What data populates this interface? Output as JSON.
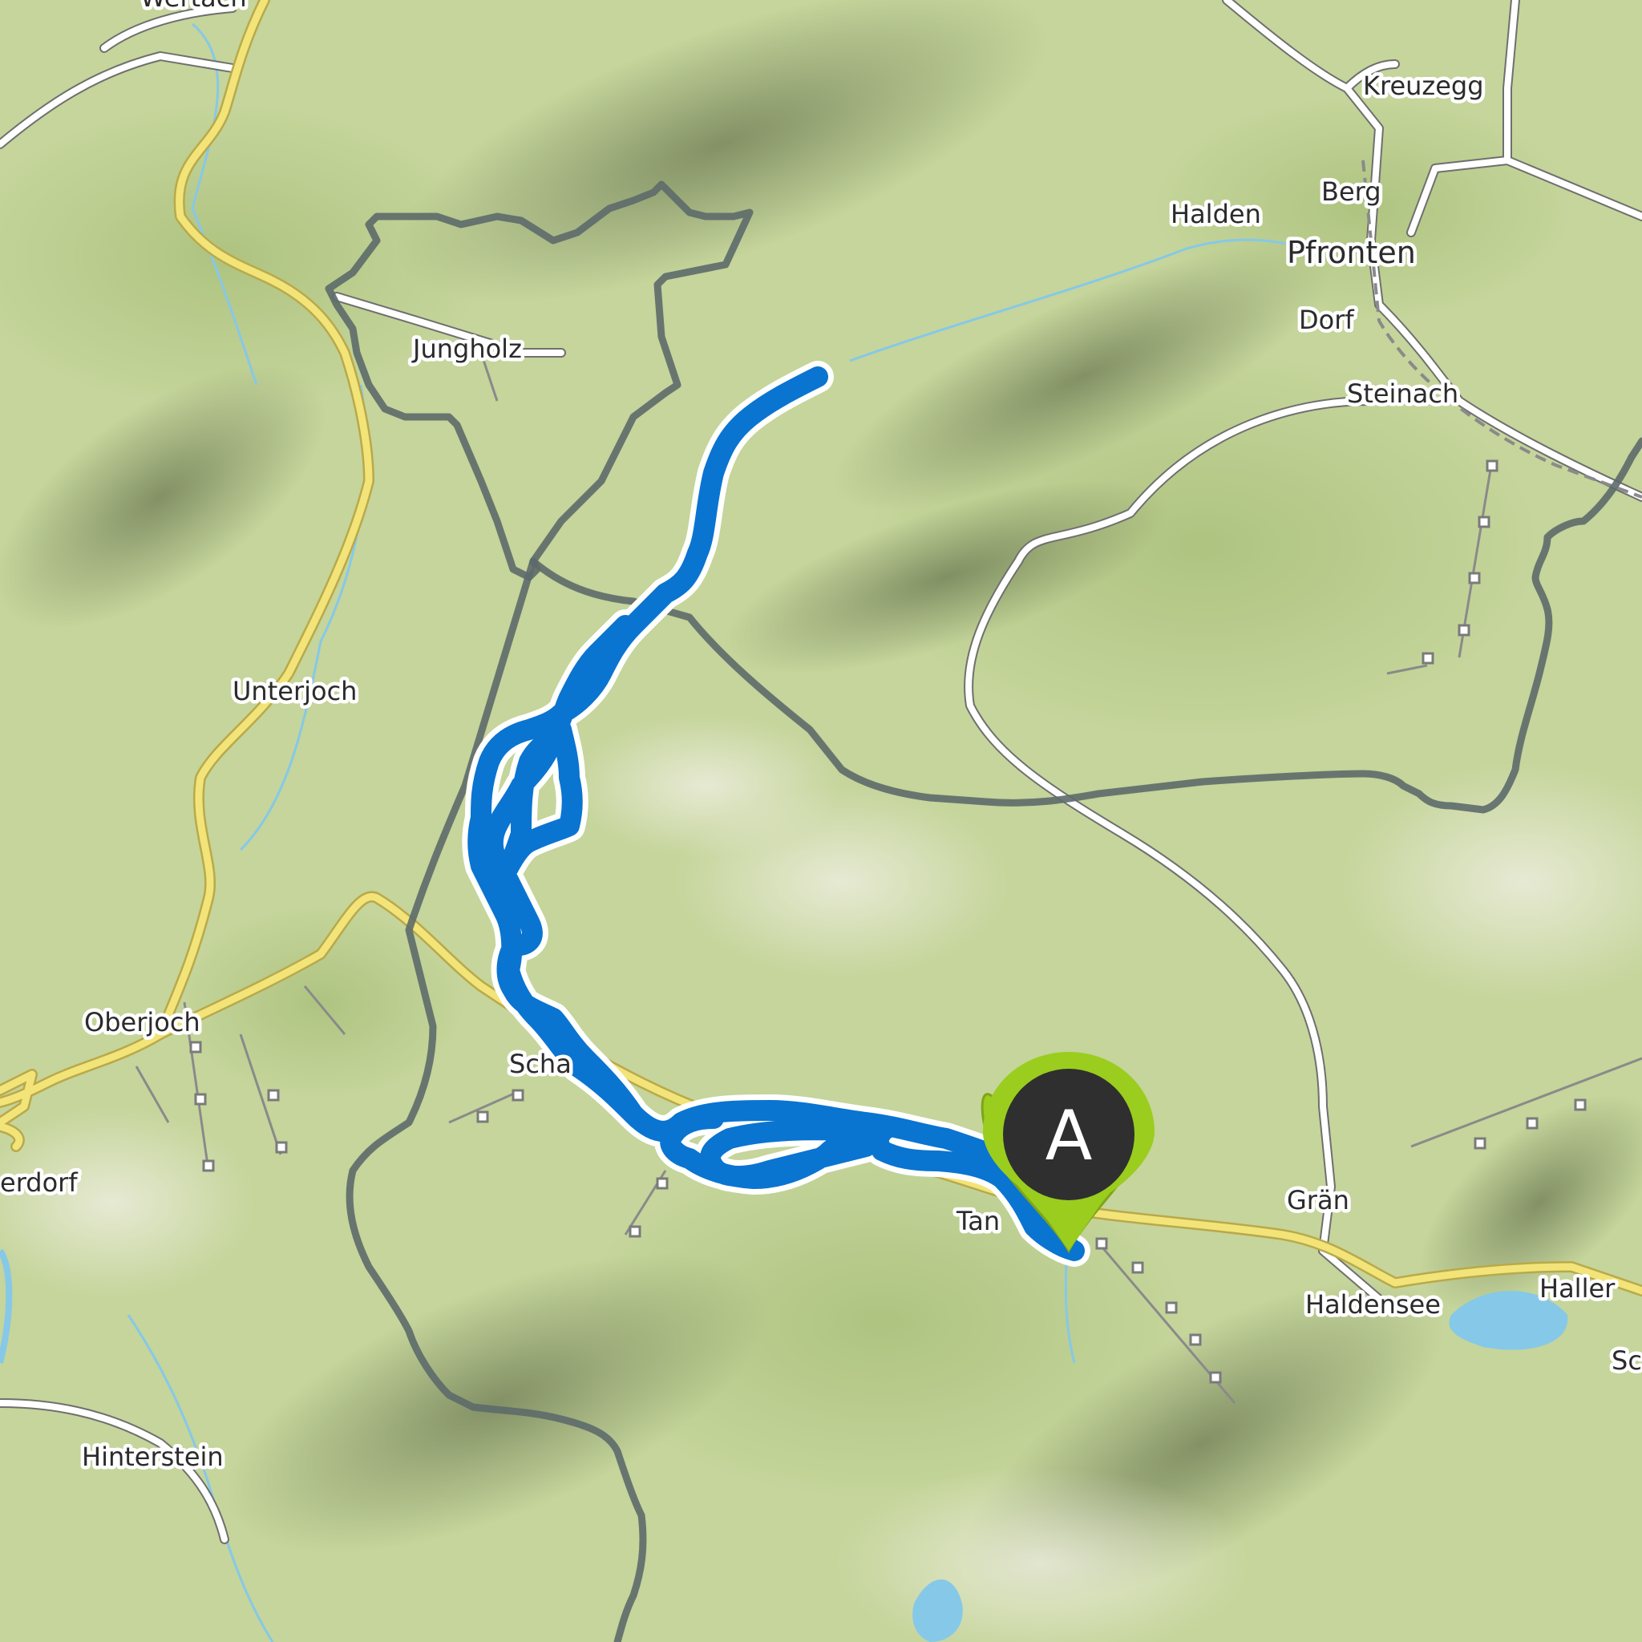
{
  "map": {
    "marker": {
      "label": "A",
      "name": "start-point"
    },
    "places": [
      {
        "id": "wertach",
        "text": "Wertach"
      },
      {
        "id": "kreuzegg",
        "text": "Kreuzegg"
      },
      {
        "id": "berg",
        "text": "Berg"
      },
      {
        "id": "halden",
        "text": "Halden"
      },
      {
        "id": "pfronten",
        "text": "Pfronten"
      },
      {
        "id": "dorf",
        "text": "Dorf"
      },
      {
        "id": "steinach",
        "text": "Steinach"
      },
      {
        "id": "jungholz",
        "text": "Jungholz"
      },
      {
        "id": "unterjoch",
        "text": "Unterjoch"
      },
      {
        "id": "oberjoch",
        "text": "Oberjoch"
      },
      {
        "id": "erdorf",
        "text": "erdorf"
      },
      {
        "id": "schattwald",
        "text": "Scha"
      },
      {
        "id": "tannheim",
        "text": "Tan"
      },
      {
        "id": "gran",
        "text": "Grän"
      },
      {
        "id": "haldensee",
        "text": "Haldensee"
      },
      {
        "id": "haller",
        "text": "Haller"
      },
      {
        "id": "hinterstein",
        "text": "Hinterstein"
      },
      {
        "id": "sc",
        "text": "Sc"
      }
    ],
    "colors": {
      "route": "#0a74d1",
      "marker_fill": "#2f2f2f",
      "marker_ring": "#9acd1e",
      "border": "#5d6a6a",
      "main_road": "#f3e479",
      "minor_road": "#ffffff",
      "water": "#86c8e8"
    },
    "icons": [
      "start-marker-icon"
    ]
  }
}
